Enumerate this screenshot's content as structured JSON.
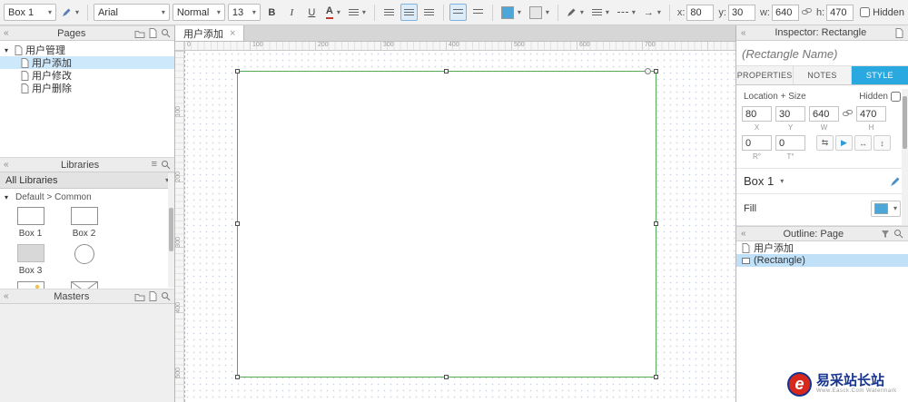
{
  "toolbar": {
    "widget_style": "Box 1",
    "font_family": "Arial",
    "font_weight": "Normal",
    "font_size": "13",
    "bold": "B",
    "italic": "I",
    "underline": "U",
    "text_color": "A",
    "x_label": "x:",
    "x": "80",
    "y_label": "y:",
    "y": "30",
    "w_label": "w:",
    "w": "640",
    "h_label": "h:",
    "h": "470",
    "hidden_label": "Hidden"
  },
  "pages": {
    "title": "Pages",
    "root_label": "用户管理",
    "items": [
      {
        "label": "用户添加"
      },
      {
        "label": "用户修改"
      },
      {
        "label": "用户删除"
      }
    ]
  },
  "libraries": {
    "title": "Libraries",
    "filter": "All Libraries",
    "section": "Default > Common",
    "items": [
      {
        "label": "Box 1"
      },
      {
        "label": "Box 2"
      },
      {
        "label": "Box 3"
      }
    ]
  },
  "masters": {
    "title": "Masters"
  },
  "canvas": {
    "tab_label": "用户添加",
    "ruler_h": [
      "0",
      "100",
      "200",
      "300",
      "400",
      "500",
      "600",
      "700"
    ],
    "ruler_v": [
      "100",
      "200",
      "300",
      "400",
      "500"
    ]
  },
  "inspector": {
    "title": "Inspector: Rectangle",
    "name_placeholder": "(Rectangle Name)",
    "tabs": {
      "properties": "PROPERTIES",
      "notes": "NOTES",
      "style": "STYLE"
    },
    "location_section": "Location + Size",
    "hidden_label": "Hidden",
    "x": "80",
    "x_label": "X",
    "y": "30",
    "y_label": "Y",
    "w": "640",
    "w_label": "W",
    "h": "470",
    "h_label": "H",
    "r": "0",
    "r_label": "R°",
    "t": "0",
    "t_label": "T°",
    "widget_style": "Box 1",
    "fill_label": "Fill"
  },
  "outline": {
    "title": "Outline: Page",
    "page_label": "用户添加",
    "selected_label": "(Rectangle)"
  },
  "watermark": {
    "brand": "易采站长站",
    "subtitle": "Www.Easck.Com Watermark",
    "logo_letter": "e"
  },
  "colors": {
    "accent_blue": "#29a9e0",
    "fill_swatch": "#4ca6d8",
    "selection_green": "#55a855"
  },
  "icons": {
    "caret": "▾",
    "collapse": "«",
    "hamburger": "≡",
    "close": "×",
    "expander": "▾",
    "arrow_right": "→",
    "flip_h": "⇆",
    "flip_v": "▶",
    "fit_w": "↔",
    "fit_h": "↕"
  }
}
